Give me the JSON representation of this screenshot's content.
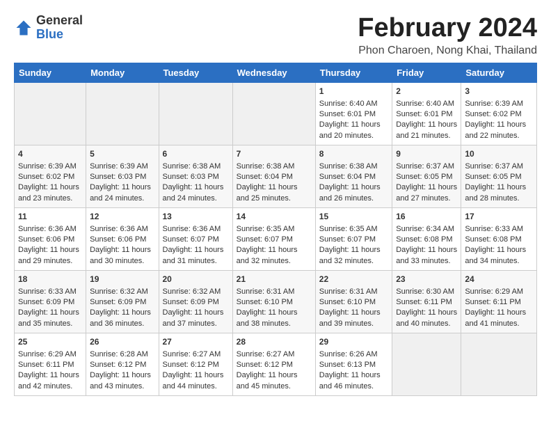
{
  "header": {
    "logo_general": "General",
    "logo_blue": "Blue",
    "main_title": "February 2024",
    "subtitle": "Phon Charoen, Nong Khai, Thailand"
  },
  "weekdays": [
    "Sunday",
    "Monday",
    "Tuesday",
    "Wednesday",
    "Thursday",
    "Friday",
    "Saturday"
  ],
  "weeks": [
    [
      {
        "day": "",
        "data": ""
      },
      {
        "day": "",
        "data": ""
      },
      {
        "day": "",
        "data": ""
      },
      {
        "day": "",
        "data": ""
      },
      {
        "day": "1",
        "data": "Sunrise: 6:40 AM\nSunset: 6:01 PM\nDaylight: 11 hours and 20 minutes."
      },
      {
        "day": "2",
        "data": "Sunrise: 6:40 AM\nSunset: 6:01 PM\nDaylight: 11 hours and 21 minutes."
      },
      {
        "day": "3",
        "data": "Sunrise: 6:39 AM\nSunset: 6:02 PM\nDaylight: 11 hours and 22 minutes."
      }
    ],
    [
      {
        "day": "4",
        "data": "Sunrise: 6:39 AM\nSunset: 6:02 PM\nDaylight: 11 hours and 23 minutes."
      },
      {
        "day": "5",
        "data": "Sunrise: 6:39 AM\nSunset: 6:03 PM\nDaylight: 11 hours and 24 minutes."
      },
      {
        "day": "6",
        "data": "Sunrise: 6:38 AM\nSunset: 6:03 PM\nDaylight: 11 hours and 24 minutes."
      },
      {
        "day": "7",
        "data": "Sunrise: 6:38 AM\nSunset: 6:04 PM\nDaylight: 11 hours and 25 minutes."
      },
      {
        "day": "8",
        "data": "Sunrise: 6:38 AM\nSunset: 6:04 PM\nDaylight: 11 hours and 26 minutes."
      },
      {
        "day": "9",
        "data": "Sunrise: 6:37 AM\nSunset: 6:05 PM\nDaylight: 11 hours and 27 minutes."
      },
      {
        "day": "10",
        "data": "Sunrise: 6:37 AM\nSunset: 6:05 PM\nDaylight: 11 hours and 28 minutes."
      }
    ],
    [
      {
        "day": "11",
        "data": "Sunrise: 6:36 AM\nSunset: 6:06 PM\nDaylight: 11 hours and 29 minutes."
      },
      {
        "day": "12",
        "data": "Sunrise: 6:36 AM\nSunset: 6:06 PM\nDaylight: 11 hours and 30 minutes."
      },
      {
        "day": "13",
        "data": "Sunrise: 6:36 AM\nSunset: 6:07 PM\nDaylight: 11 hours and 31 minutes."
      },
      {
        "day": "14",
        "data": "Sunrise: 6:35 AM\nSunset: 6:07 PM\nDaylight: 11 hours and 32 minutes."
      },
      {
        "day": "15",
        "data": "Sunrise: 6:35 AM\nSunset: 6:07 PM\nDaylight: 11 hours and 32 minutes."
      },
      {
        "day": "16",
        "data": "Sunrise: 6:34 AM\nSunset: 6:08 PM\nDaylight: 11 hours and 33 minutes."
      },
      {
        "day": "17",
        "data": "Sunrise: 6:33 AM\nSunset: 6:08 PM\nDaylight: 11 hours and 34 minutes."
      }
    ],
    [
      {
        "day": "18",
        "data": "Sunrise: 6:33 AM\nSunset: 6:09 PM\nDaylight: 11 hours and 35 minutes."
      },
      {
        "day": "19",
        "data": "Sunrise: 6:32 AM\nSunset: 6:09 PM\nDaylight: 11 hours and 36 minutes."
      },
      {
        "day": "20",
        "data": "Sunrise: 6:32 AM\nSunset: 6:09 PM\nDaylight: 11 hours and 37 minutes."
      },
      {
        "day": "21",
        "data": "Sunrise: 6:31 AM\nSunset: 6:10 PM\nDaylight: 11 hours and 38 minutes."
      },
      {
        "day": "22",
        "data": "Sunrise: 6:31 AM\nSunset: 6:10 PM\nDaylight: 11 hours and 39 minutes."
      },
      {
        "day": "23",
        "data": "Sunrise: 6:30 AM\nSunset: 6:11 PM\nDaylight: 11 hours and 40 minutes."
      },
      {
        "day": "24",
        "data": "Sunrise: 6:29 AM\nSunset: 6:11 PM\nDaylight: 11 hours and 41 minutes."
      }
    ],
    [
      {
        "day": "25",
        "data": "Sunrise: 6:29 AM\nSunset: 6:11 PM\nDaylight: 11 hours and 42 minutes."
      },
      {
        "day": "26",
        "data": "Sunrise: 6:28 AM\nSunset: 6:12 PM\nDaylight: 11 hours and 43 minutes."
      },
      {
        "day": "27",
        "data": "Sunrise: 6:27 AM\nSunset: 6:12 PM\nDaylight: 11 hours and 44 minutes."
      },
      {
        "day": "28",
        "data": "Sunrise: 6:27 AM\nSunset: 6:12 PM\nDaylight: 11 hours and 45 minutes."
      },
      {
        "day": "29",
        "data": "Sunrise: 6:26 AM\nSunset: 6:13 PM\nDaylight: 11 hours and 46 minutes."
      },
      {
        "day": "",
        "data": ""
      },
      {
        "day": "",
        "data": ""
      }
    ]
  ]
}
